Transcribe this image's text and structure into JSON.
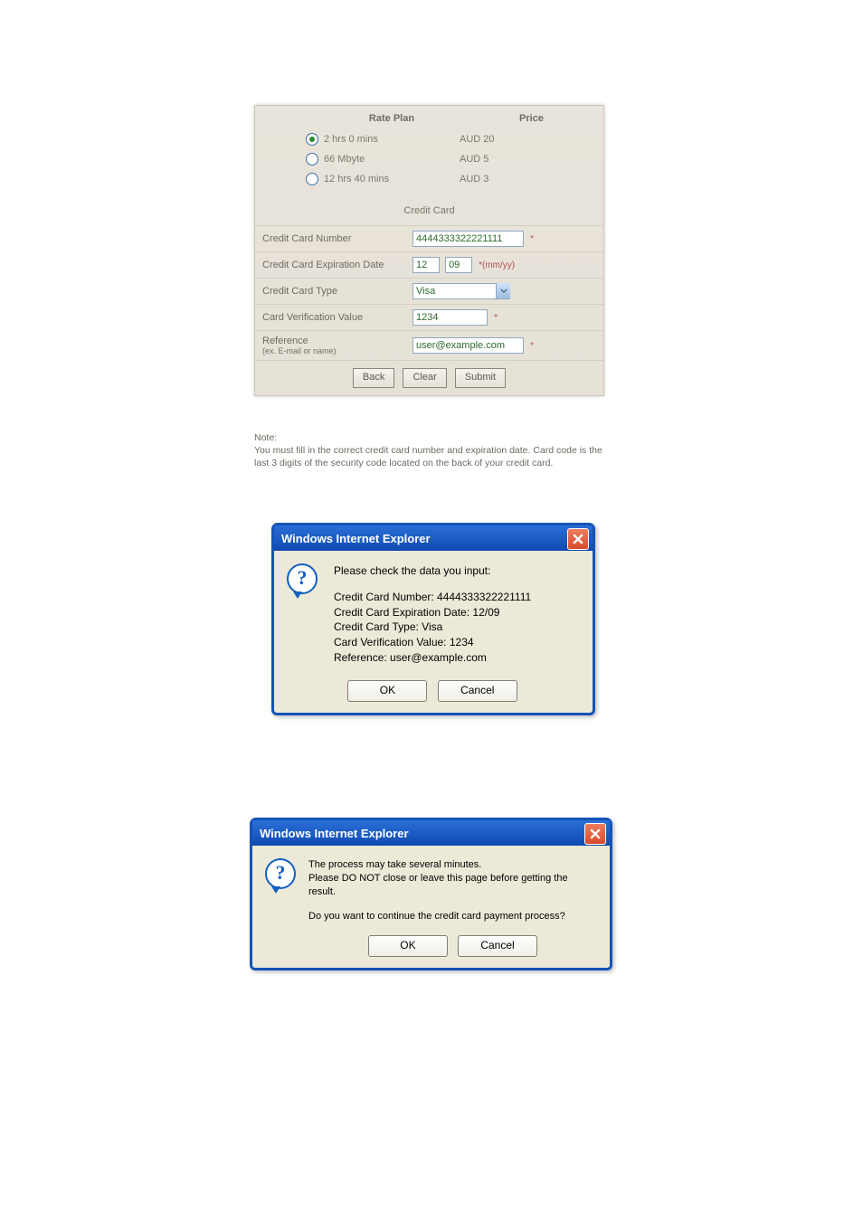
{
  "form": {
    "plan_header": "Rate Plan",
    "price_header": "Price",
    "plans": [
      {
        "name": "2 hrs 0 mins",
        "price": "AUD 20",
        "selected": true
      },
      {
        "name": "66 Mbyte",
        "price": "AUD 5",
        "selected": false
      },
      {
        "name": "12 hrs 40 mins",
        "price": "AUD 3",
        "selected": false
      }
    ],
    "section_title": "Credit Card",
    "fields": {
      "cc_number_label": "Credit Card Number",
      "cc_number_value": "4444333322221111",
      "cc_number_mark": "*",
      "exp_label": "Credit Card Expiration Date",
      "exp_mm": "12",
      "exp_yy": "09",
      "exp_hint": "*(mm/yy)",
      "cc_type_label": "Credit Card Type",
      "cc_type_value": "Visa",
      "cvv_label": "Card Verification Value",
      "cvv_value": "1234",
      "cvv_mark": "*",
      "ref_label": "Reference",
      "ref_sublabel": "(ex. E-mail or name)",
      "ref_value": "user@example.com",
      "ref_mark": "*"
    },
    "buttons": {
      "back": "Back",
      "clear": "Clear",
      "submit": "Submit"
    },
    "note_title": "Note:",
    "note_body": "You must fill in the correct credit card number and expiration date. Card code is the last 3 digits of the security code located on the back of your credit card."
  },
  "dlg1": {
    "title": "Windows Internet Explorer",
    "line1": "Please check the data you input:",
    "line2": "Credit Card Number: 4444333322221111",
    "line3": "Credit Card Expiration Date: 12/09",
    "line4": "Credit Card Type: Visa",
    "line5": "Card Verification Value: 1234",
    "line6": "Reference: user@example.com",
    "ok": "OK",
    "cancel": "Cancel"
  },
  "dlg2": {
    "title": "Windows Internet Explorer",
    "line1": "The process may take several minutes.",
    "line2": "Please DO NOT close or leave this page before getting the result.",
    "line3": "Do you want to continue the credit card payment process?",
    "ok": "OK",
    "cancel": "Cancel"
  }
}
